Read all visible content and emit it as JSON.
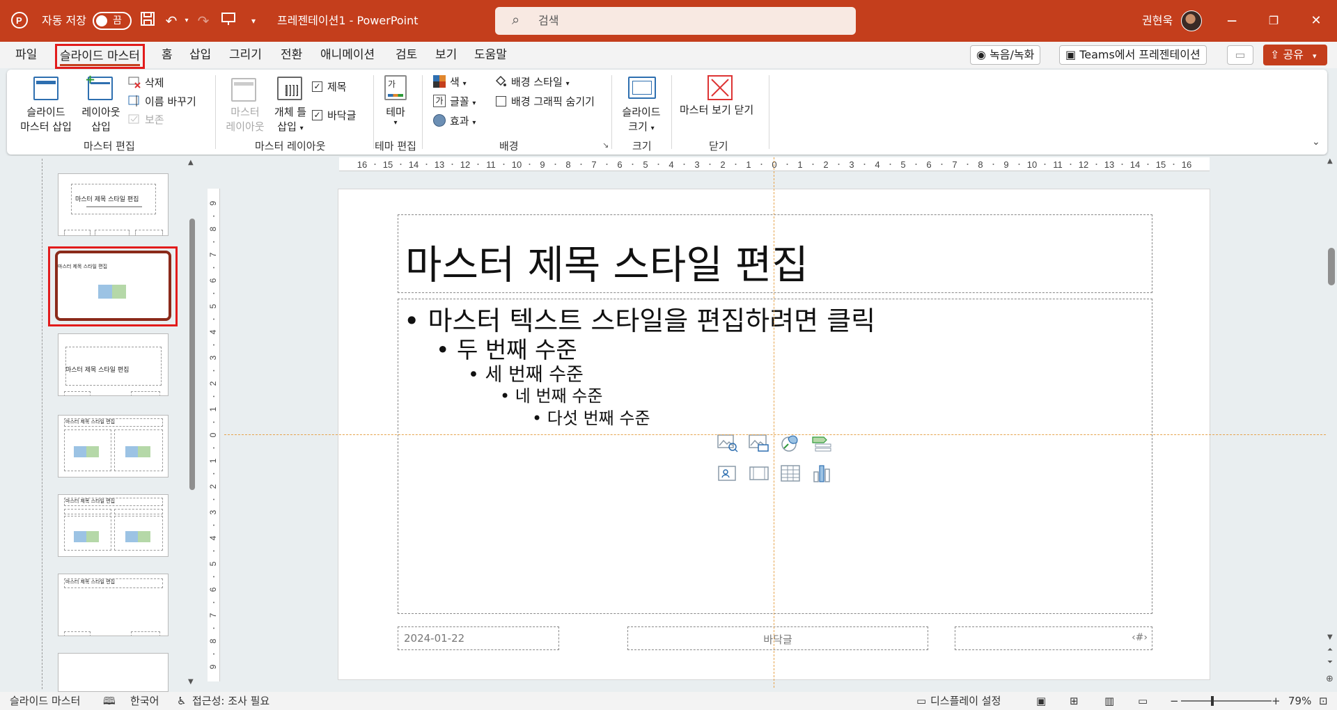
{
  "titlebar": {
    "autosave_label": "자동 저장",
    "autosave_state": "끔",
    "doc_title": "프레젠테이션1  -  PowerPoint",
    "search_placeholder": "검색",
    "user_name": "권현욱",
    "minimize": "─",
    "restore": "❐",
    "close": "✕"
  },
  "menu": {
    "tabs": [
      "파일",
      "슬라이드 마스터",
      "홈",
      "삽입",
      "그리기",
      "전환",
      "애니메이션",
      "검토",
      "보기",
      "도움말"
    ],
    "record_label": "녹음/녹화",
    "teams_label": "Teams에서 프레젠테이션",
    "share_label": "공유"
  },
  "ribbon": {
    "edit_master": {
      "title": "마스터 편집",
      "insert_master_1": "슬라이드",
      "insert_master_2": "마스터 삽입",
      "insert_layout_1": "레이아웃",
      "insert_layout_2": "삽입",
      "delete": "삭제",
      "rename": "이름 바꾸기",
      "preserve": "보존"
    },
    "master_layout": {
      "title": "마스터 레이아웃",
      "master_layout_1": "마스터",
      "master_layout_2": "레이아웃",
      "insert_placeholder_1": "개체 틀",
      "insert_placeholder_2": "삽입",
      "title_check": "제목",
      "footer_check": "바닥글"
    },
    "edit_theme": {
      "title": "테마 편집",
      "theme": "테마"
    },
    "background": {
      "title": "배경",
      "colors": "색",
      "fonts": "글꼴",
      "effects": "효과",
      "bg_styles": "배경 스타일",
      "hide_bg": "배경 그래픽 숨기기"
    },
    "size": {
      "title": "크기",
      "slide_size_1": "슬라이드",
      "slide_size_2": "크기"
    },
    "close": {
      "title": "닫기",
      "close_master": "마스터 보기 닫기"
    }
  },
  "thumbnails": {
    "thumb_title": "마스터 제목 스타일 편집"
  },
  "slide": {
    "title": "마스터 제목 스타일 편집",
    "levels": [
      "마스터 텍스트 스타일을 편집하려면 클릭",
      "두 번째 수준",
      "세 번째 수준",
      "네 번째 수준",
      "다섯 번째 수준"
    ],
    "date": "2024-01-22",
    "footer": "바닥글",
    "page_num": "‹#›"
  },
  "ruler": {
    "h_ticks": [
      "16",
      "15",
      "14",
      "13",
      "12",
      "11",
      "10",
      "9",
      "8",
      "7",
      "6",
      "5",
      "4",
      "3",
      "2",
      "1",
      "0",
      "1",
      "2",
      "3",
      "4",
      "5",
      "6",
      "7",
      "8",
      "9",
      "10",
      "11",
      "12",
      "13",
      "14",
      "15",
      "16"
    ],
    "v_ticks": [
      "9",
      "8",
      "7",
      "6",
      "5",
      "4",
      "3",
      "2",
      "1",
      "0",
      "1",
      "2",
      "3",
      "4",
      "5",
      "6",
      "7",
      "8",
      "9"
    ]
  },
  "statusbar": {
    "view_name": "슬라이드 마스터",
    "language": "한국어",
    "accessibility": "접근성: 조사 필요",
    "display_settings": "디스플레이 설정",
    "zoom": "79%"
  },
  "colors": {
    "accent": "#c43e1c",
    "highlight": "#e21b1b",
    "guide": "#e6a34b"
  }
}
